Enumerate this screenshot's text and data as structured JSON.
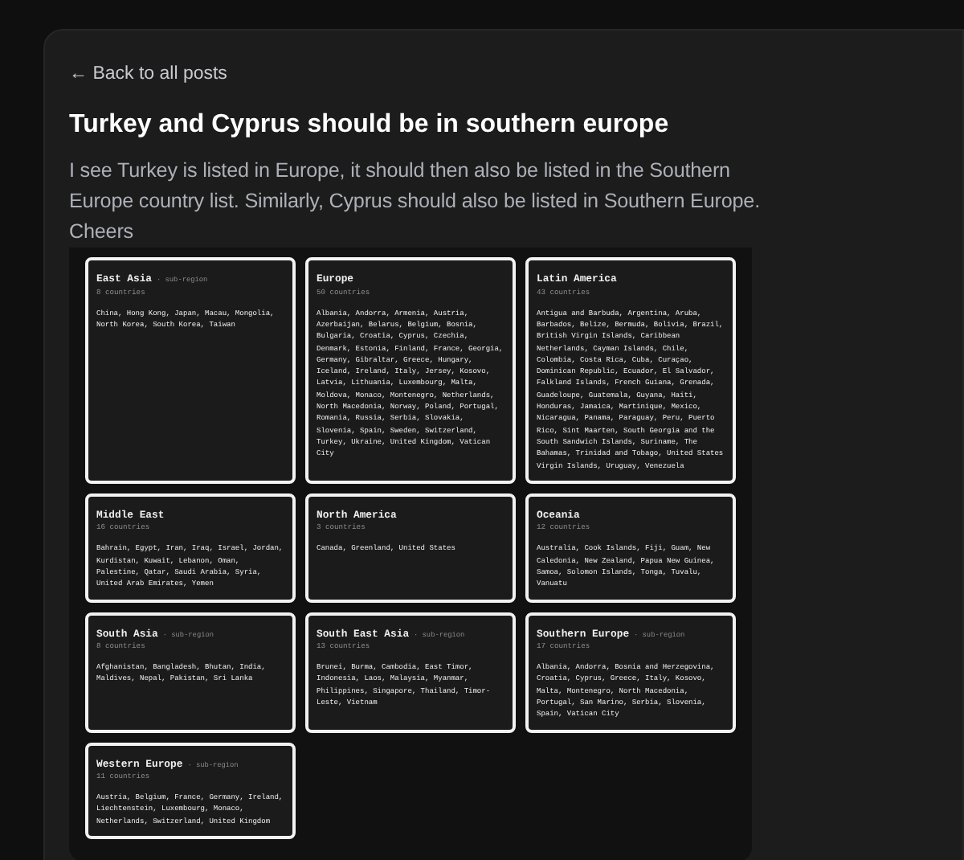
{
  "back_link": "← Back to all posts",
  "post": {
    "title": "Turkey and Cyprus should be in southern europe",
    "body": "I see Turkey is listed in Europe, it should then also be listed in the Southern Europe country list. Similarly, Cyprus should also be listed in Southern Europe. Cheers"
  },
  "screenshot": {
    "regions": [
      {
        "name": "East Asia",
        "tag": "· sub-region",
        "count": "8 countries",
        "countries": "China, Hong Kong, Japan, Macau, Mongolia, North Korea, South Korea, Taiwan"
      },
      {
        "name": "Europe",
        "count": "50 countries",
        "countries": "Albania, Andorra, Armenia, Austria, Azerbaijan, Belarus, Belgium, Bosnia, Bulgaria, Croatia, Cyprus, Czechia, Denmark, Estonia, Finland, France, Georgia, Germany, Gibraltar, Greece, Hungary, Iceland, Ireland, Italy, Jersey, Kosovo, Latvia, Lithuania, Luxembourg, Malta, Moldova, Monaco, Montenegro, Netherlands, North Macedonia, Norway, Poland, Portugal, Romania, Russia, Serbia, Slovakia, Slovenia, Spain, Sweden, Switzerland, Turkey, Ukraine, United Kingdom, Vatican City"
      },
      {
        "name": "Latin America",
        "count": "43 countries",
        "countries": "Antigua and Barbuda, Argentina, Aruba, Barbados, Belize, Bermuda, Bolivia, Brazil, British Virgin Islands, Caribbean Netherlands, Cayman Islands, Chile, Colombia, Costa Rica, Cuba, Curaçao, Dominican Republic, Ecuador, El Salvador, Falkland Islands, French Guiana, Grenada, Guadeloupe, Guatemala, Guyana, Haiti, Honduras, Jamaica, Martinique, Mexico, Nicaragua, Panama, Paraguay, Peru, Puerto Rico, Sint Maarten, South Georgia and the South Sandwich Islands, Suriname, The Bahamas, Trinidad and Tobago, United States Virgin Islands, Uruguay, Venezuela"
      },
      {
        "name": "Middle East",
        "count": "16 countries",
        "countries": "Bahrain, Egypt, Iran, Iraq, Israel, Jordan, Kurdistan, Kuwait, Lebanon, Oman, Palestine, Qatar, Saudi Arabia, Syria, United Arab Emirates, Yemen"
      },
      {
        "name": "North America",
        "count": "3 countries",
        "countries": "Canada, Greenland, United States"
      },
      {
        "name": "Oceania",
        "count": "12 countries",
        "countries": "Australia, Cook Islands, Fiji, Guam, New Caledonia, New Zealand, Papua New Guinea, Samoa, Solomon Islands, Tonga, Tuvalu, Vanuatu"
      },
      {
        "name": "South Asia",
        "tag": "· sub-region",
        "count": "8 countries",
        "countries": "Afghanistan, Bangladesh, Bhutan, India, Maldives, Nepal, Pakistan, Sri Lanka"
      },
      {
        "name": "South East Asia",
        "tag": "· sub-region",
        "count": "13 countries",
        "countries": "Brunei, Burma, Cambodia, East Timor, Indonesia, Laos, Malaysia, Myanmar, Philippines, Singapore, Thailand, Timor-Leste, Vietnam"
      },
      {
        "name": "Southern Europe",
        "tag": "· sub-region",
        "count": "17 countries",
        "countries": "Albania, Andorra, Bosnia and Herzegovina, Croatia, Cyprus, Greece, Italy, Kosovo, Malta, Montenegro, North Macedonia, Portugal, San Marino, Serbia, Slovenia, Spain, Vatican City"
      },
      {
        "name": "Western Europe",
        "tag": "· sub-region",
        "count": "11 countries",
        "countries": "Austria, Belgium, France, Germany, Ireland, Liechtenstein, Luxembourg, Monaco, Netherlands, Switzerland, United Kingdom"
      }
    ]
  }
}
